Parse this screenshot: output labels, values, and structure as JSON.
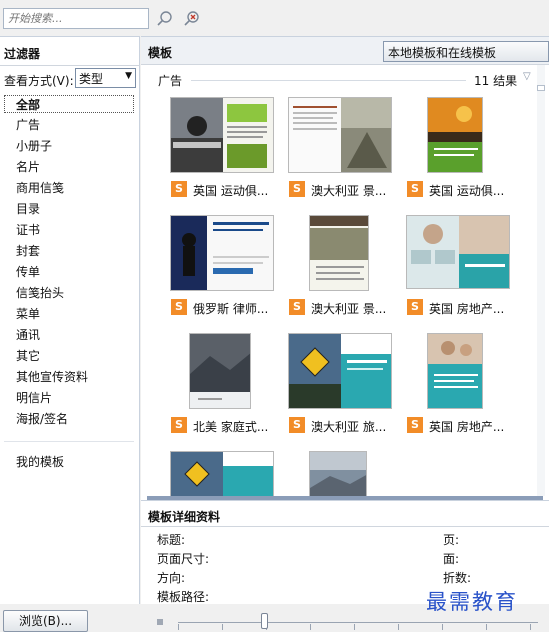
{
  "search": {
    "placeholder": "开始搜索...",
    "search_icon": "magnifier-icon",
    "clear_icon": "clear-search-icon"
  },
  "filter": {
    "title": "过滤器",
    "view_label": "查看方式(V):",
    "view_value": "类型",
    "items": [
      "全部",
      "广告",
      "小册子",
      "名片",
      "商用信笺",
      "目录",
      "证书",
      "封套",
      "传单",
      "信笺抬头",
      "菜单",
      "通讯",
      "其它",
      "其他宣传资料",
      "明信片",
      "海报/签名"
    ],
    "my_templates": "我的模板"
  },
  "templates": {
    "title": "模板",
    "source": "本地模板和在线模板",
    "group_label": "广告",
    "count": "11 结果",
    "cards": [
      {
        "label": "英国 运动俱..."
      },
      {
        "label": "澳大利亚 景..."
      },
      {
        "label": "英国 运动俱..."
      },
      {
        "label": "俄罗斯 律师..."
      },
      {
        "label": "澳大利亚 景..."
      },
      {
        "label": "英国 房地产..."
      },
      {
        "label": "北美 家庭式..."
      },
      {
        "label": "澳大利亚 旅..."
      },
      {
        "label": "英国 房地产..."
      },
      {
        "label": ""
      },
      {
        "label": ""
      }
    ],
    "card_icon_letter": "S"
  },
  "details": {
    "title": "模板详细资料",
    "fields_left": [
      "标题:",
      "页面尺寸:",
      "方向:",
      "模板路径:"
    ],
    "fields_right": [
      "页:",
      "面:",
      "折数:"
    ]
  },
  "bottom": {
    "browse": "浏览(B)..."
  },
  "watermark": "最需教育"
}
